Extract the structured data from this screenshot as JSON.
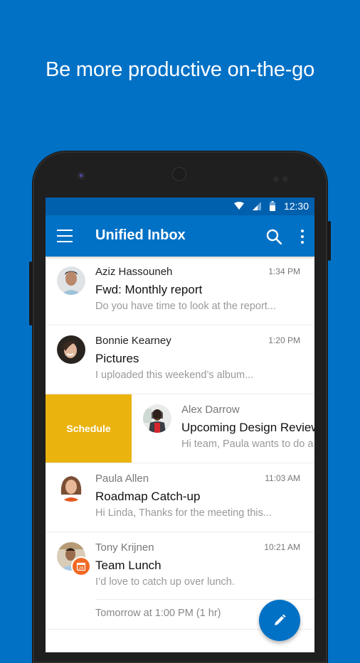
{
  "headline": "Be more productive on-the-go",
  "status_bar": {
    "time": "12:30",
    "icons": [
      "wifi-icon",
      "signal-icon",
      "battery-icon"
    ]
  },
  "app_bar": {
    "title": "Unified Inbox",
    "menu_icon": "hamburger-menu-icon",
    "search_icon": "search-icon",
    "more_icon": "more-vertical-icon"
  },
  "messages": [
    {
      "sender": "Aziz Hassouneh",
      "time": "1:34 PM",
      "subject": "Fwd: Monthly report",
      "preview": "Do you have time to look at the report...",
      "unread": true
    },
    {
      "sender": "Bonnie Kearney",
      "time": "1:20 PM",
      "subject": "Pictures",
      "preview": "I uploaded this weekend’s album...",
      "unread": true
    },
    {
      "sender": "Alex Darrow",
      "time": "",
      "subject": "Upcoming Design Review",
      "preview": "Hi team, Paula wants to do a",
      "unread": false,
      "swipe_action": "Schedule"
    },
    {
      "sender": "Paula Allen",
      "time": "11:03 AM",
      "subject": "Roadmap Catch-up",
      "preview": "Hi Linda, Thanks for the meeting this...",
      "unread": false
    },
    {
      "sender": "Tony Krijnen",
      "time": "10:21 AM",
      "subject": "Team Lunch",
      "preview": "I’d love to catch up over lunch.",
      "unread": false,
      "calendar_badge_day": "28",
      "event": "Tomorrow at 1:00 PM (1 hr)"
    }
  ],
  "fab": {
    "icon": "compose-pencil-icon"
  },
  "colors": {
    "brand_blue": "#0171c6",
    "status_bar_blue": "#0060ad",
    "schedule_yellow": "#eab30e",
    "calendar_orange": "#f26a25"
  }
}
